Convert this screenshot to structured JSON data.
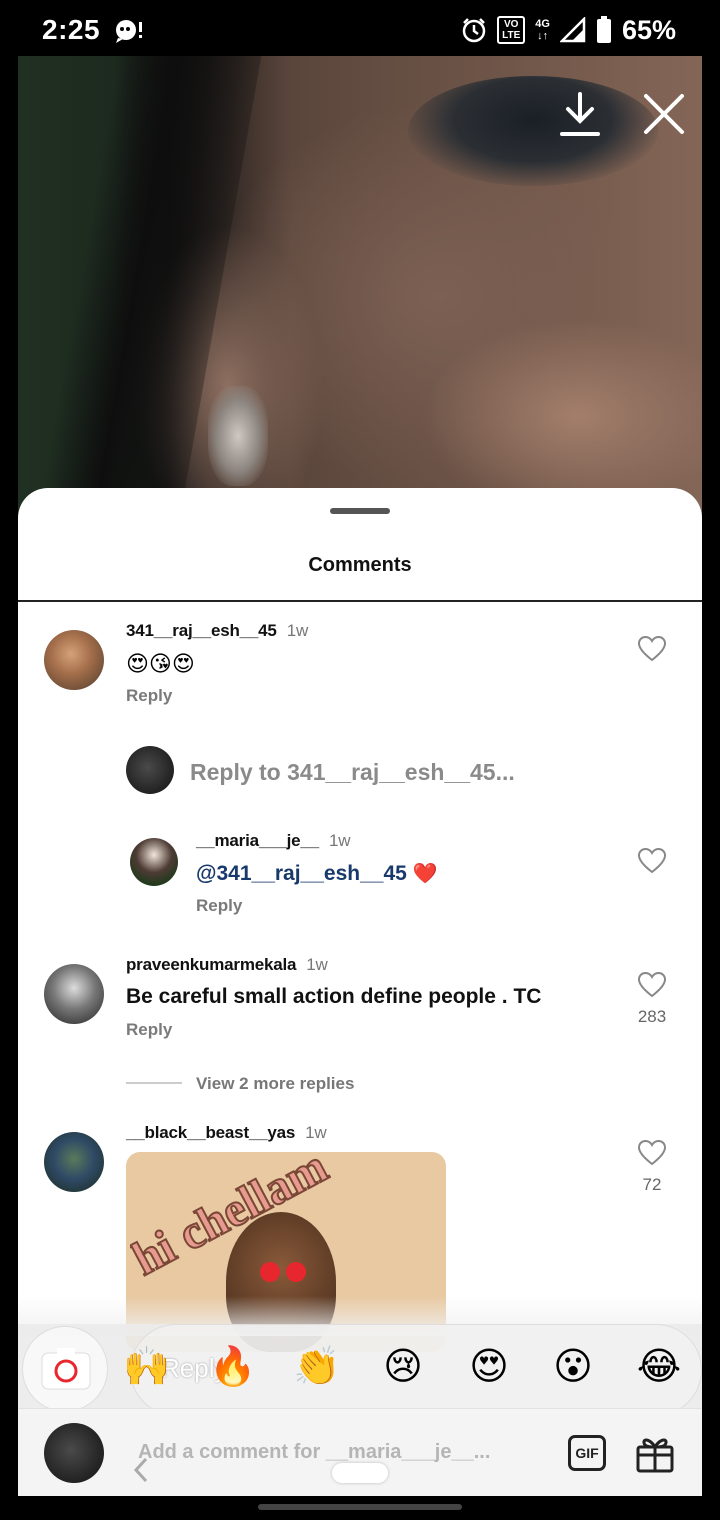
{
  "status_bar": {
    "time": "2:25",
    "network_badge": "VO\nLTE",
    "network_type": "4G",
    "battery": "65%",
    "icons": [
      "notification-icon",
      "alarm-icon",
      "volte-icon",
      "data-arrows-icon",
      "signal-icon",
      "battery-icon"
    ]
  },
  "video": {
    "actions": [
      "download-icon",
      "close-icon"
    ]
  },
  "comments_sheet": {
    "title": "Comments",
    "comments": [
      {
        "username": "341__raj__esh__45",
        "time": "1w",
        "text": "😍😘😍",
        "reply_label": "Reply",
        "likes": ""
      },
      {
        "username": "praveenkumarmekala",
        "time": "1w",
        "text": "Be careful small action define people . TC",
        "reply_label": "Reply",
        "likes": "283"
      },
      {
        "username": "__black__beast__yas",
        "time": "1w",
        "likes": "72",
        "gif_text": "hi chellam"
      }
    ],
    "reply_prompt": "Reply to 341__raj__esh__45...",
    "nested_reply": {
      "username": "__maria___je__",
      "time": "1w",
      "mention": "@341__raj__esh__45",
      "emoji": "❤️",
      "reply_label": "Reply"
    },
    "view_more": "View 2 more replies"
  },
  "emoji_bar": {
    "reply_placeholder": "Reply...",
    "emojis": [
      "🙌",
      "🔥",
      "👏",
      "😢",
      "😍",
      "😮",
      "😂"
    ]
  },
  "comment_bar": {
    "placeholder": "Add a comment for __maria___je__...",
    "gif_label": "GIF"
  },
  "colors": {
    "mention": "#18396b",
    "heart_red": "#e8262d"
  }
}
